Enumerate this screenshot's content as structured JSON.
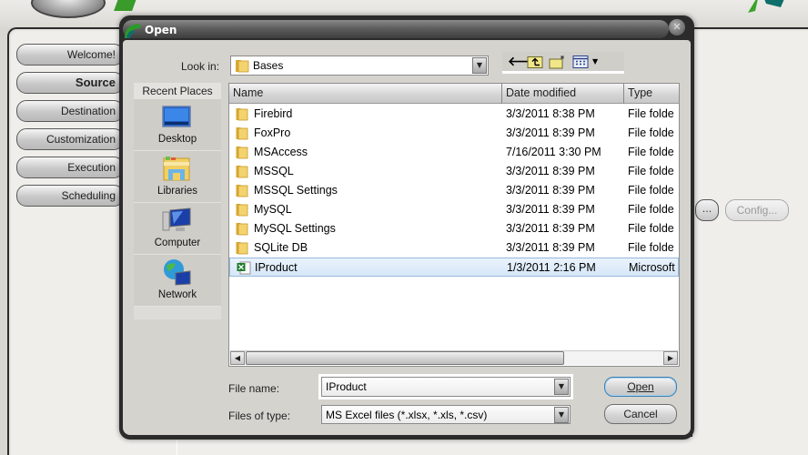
{
  "app": {
    "nav": [
      {
        "label": "Welcome!",
        "active": false
      },
      {
        "label": "Source",
        "active": true
      },
      {
        "label": "Destination",
        "active": false
      },
      {
        "label": "Customization",
        "active": false
      },
      {
        "label": "Execution",
        "active": false
      },
      {
        "label": "Scheduling",
        "active": false
      }
    ],
    "ellipsis_label": "...",
    "config_label": "Config..."
  },
  "dialog": {
    "title": "Open",
    "close_icon": "close-icon",
    "look_in_label": "Look in:",
    "look_in_value": "Bases",
    "toolbar": {
      "back_icon": "back-arrow-icon",
      "up_icon": "up-folder-icon",
      "new_folder_icon": "new-folder-icon",
      "view_icon": "view-menu-icon"
    },
    "places": {
      "header": "Recent Places",
      "items": [
        {
          "label": "Desktop",
          "icon": "desktop-icon"
        },
        {
          "label": "Libraries",
          "icon": "libraries-icon"
        },
        {
          "label": "Computer",
          "icon": "computer-icon"
        },
        {
          "label": "Network",
          "icon": "network-icon"
        }
      ]
    },
    "columns": [
      "Name",
      "Date modified",
      "Type"
    ],
    "files": [
      {
        "name": "Firebird",
        "date": "3/3/2011 8:38 PM",
        "type": "File folde",
        "kind": "folder"
      },
      {
        "name": "FoxPro",
        "date": "3/3/2011 8:39 PM",
        "type": "File folde",
        "kind": "folder"
      },
      {
        "name": "MSAccess",
        "date": "7/16/2011 3:30 PM",
        "type": "File folde",
        "kind": "folder"
      },
      {
        "name": "MSSQL",
        "date": "3/3/2011 8:39 PM",
        "type": "File folde",
        "kind": "folder"
      },
      {
        "name": "MSSQL Settings",
        "date": "3/3/2011 8:39 PM",
        "type": "File folde",
        "kind": "folder"
      },
      {
        "name": "MySQL",
        "date": "3/3/2011 8:39 PM",
        "type": "File folde",
        "kind": "folder"
      },
      {
        "name": "MySQL Settings",
        "date": "3/3/2011 8:39 PM",
        "type": "File folde",
        "kind": "folder"
      },
      {
        "name": "SQLite DB",
        "date": "3/3/2011 8:39 PM",
        "type": "File folde",
        "kind": "folder"
      },
      {
        "name": "IProduct",
        "date": "1/3/2011 2:16 PM",
        "type": "Microsoft",
        "kind": "excel",
        "selected": true
      }
    ],
    "file_name_label": "File name:",
    "file_name_value": "IProduct",
    "file_type_label": "Files of type:",
    "file_type_value": "MS Excel files (*.xlsx, *.xls, *.csv)",
    "open_label": "Open",
    "cancel_label": "Cancel"
  },
  "colors": {
    "selection": "#d7e7f8",
    "selection_border": "#98b8dc",
    "dialog_frame": "#2b2b2b",
    "default_button_border": "#3c7fb1"
  }
}
